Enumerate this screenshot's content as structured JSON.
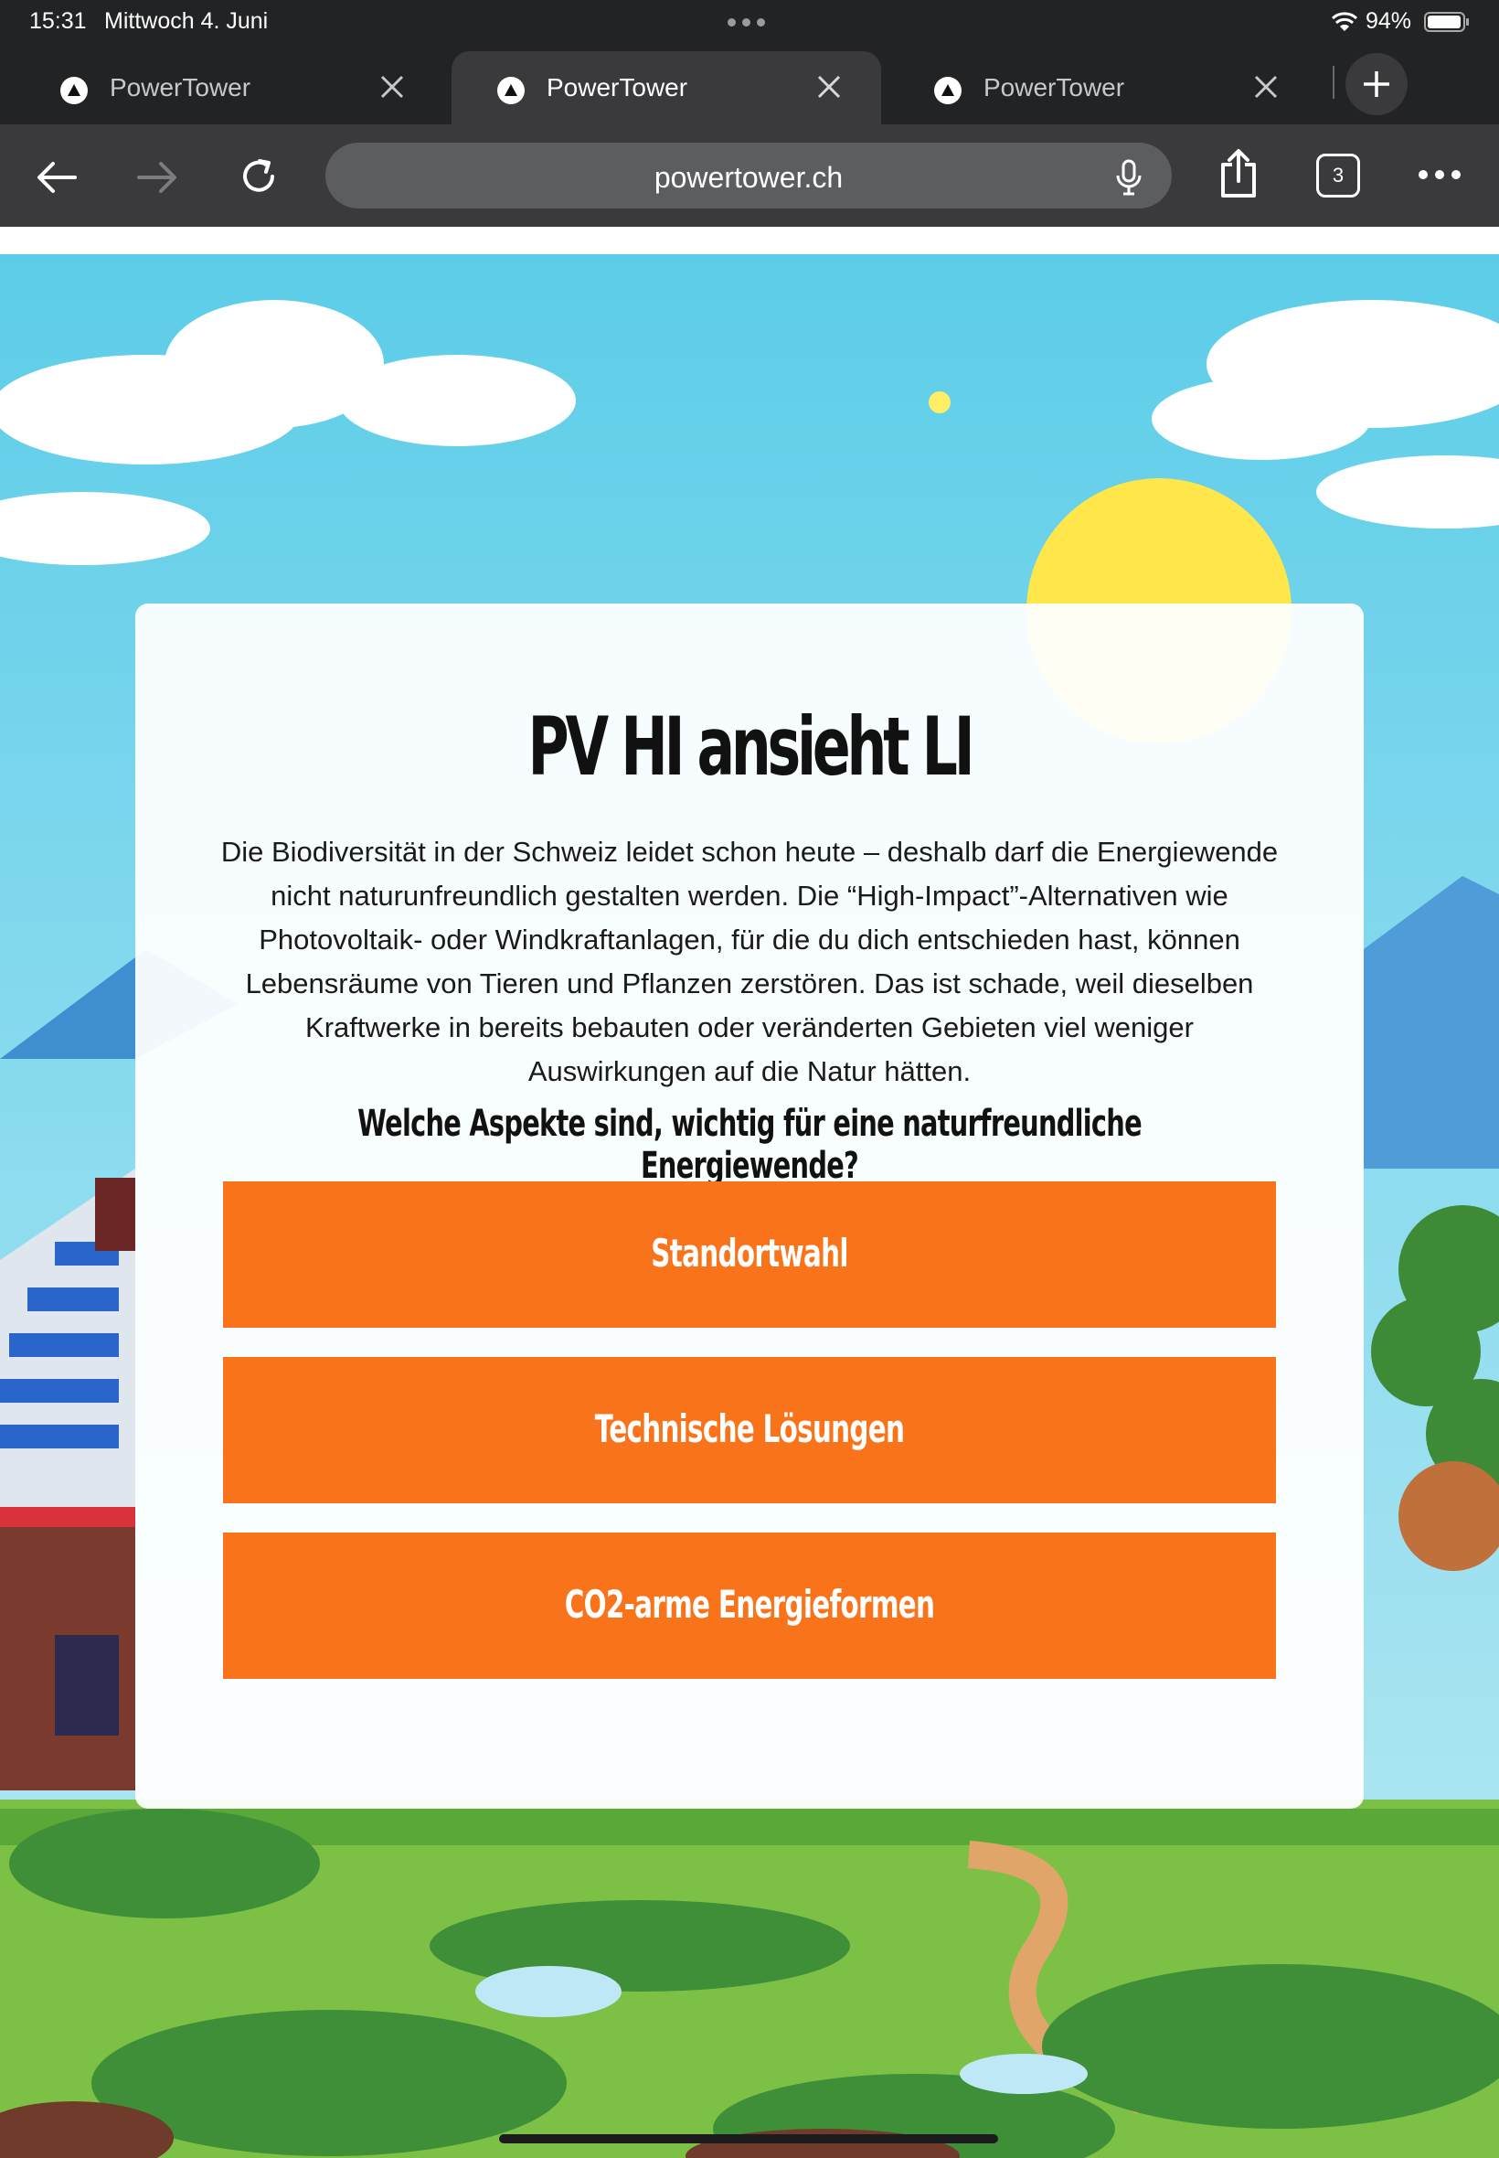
{
  "status_bar": {
    "time": "15:31",
    "date": "Mittwoch 4. Juni",
    "battery": "94%"
  },
  "tabs": [
    {
      "title": "PowerTower",
      "active": false
    },
    {
      "title": "PowerTower",
      "active": true
    },
    {
      "title": "PowerTower",
      "active": false
    }
  ],
  "toolbar": {
    "address": "powertower.ch",
    "tab_count": "3"
  },
  "card": {
    "title": "PV HI ansieht LI",
    "body": "Die Biodiversität in der Schweiz leidet schon heute – deshalb darf die Energiewende nicht naturunfreundlich gestalten werden. Die “High-Impact”-Alternativen wie Photovoltaik- oder Windkraftanlagen, für die du dich entschieden hast, können Lebensräume von Tieren und Pflanzen zerstören. Das ist schade, weil dieselben Kraftwerke in bereits bebauten oder veränderten Gebieten viel weniger Auswirkungen auf die Natur hätten.",
    "question": "Welche Aspekte sind, wichtig für eine naturfreundliche Energiewende?",
    "choices": [
      "Standortwahl",
      "Technische Lösungen",
      "CO2-arme Energieformen"
    ]
  },
  "colors": {
    "accent": "#f9731a",
    "chrome_dark": "#222325",
    "chrome_toolbar": "#3a3a3d",
    "sky": "#6fd0ea"
  }
}
